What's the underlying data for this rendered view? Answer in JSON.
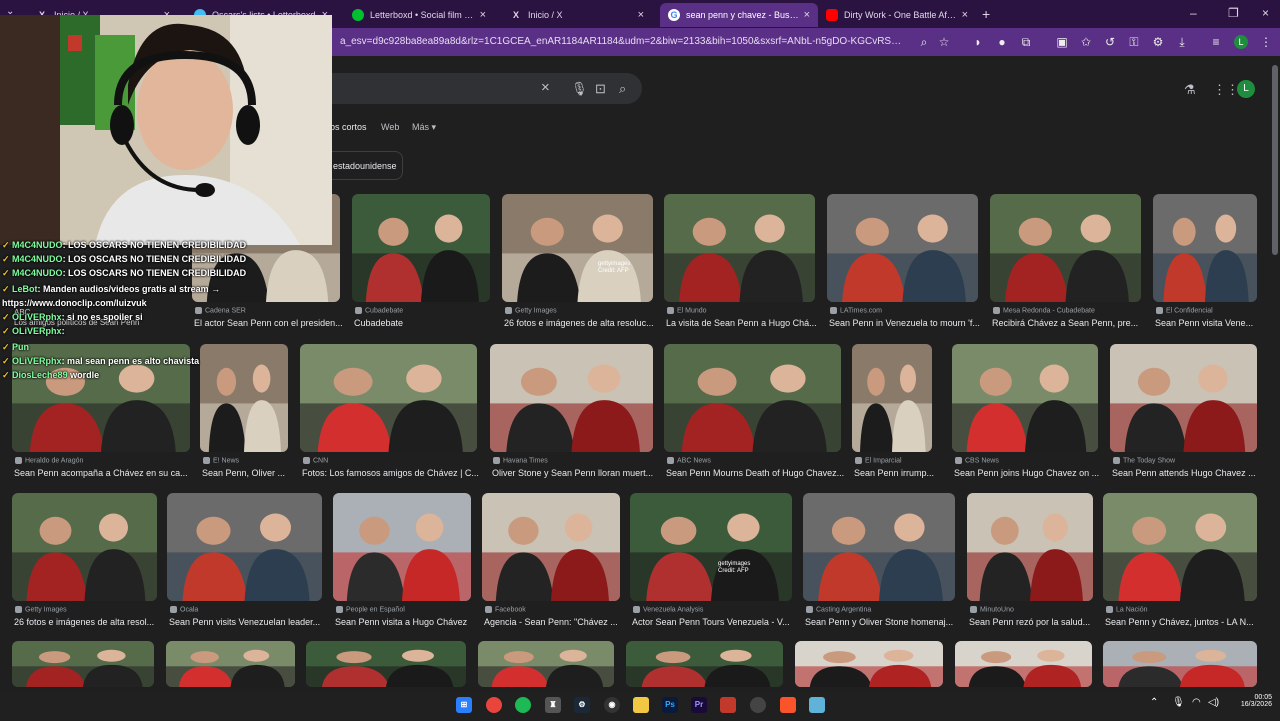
{
  "tabs": [
    {
      "label": "Inicio / X",
      "icon": "x-logo-icon"
    },
    {
      "label": "Oscars's lists • Letterboxd",
      "icon": "letterboxd-icon"
    },
    {
      "label": "Letterboxd • Social film discove",
      "icon": "letterboxd-icon"
    },
    {
      "label": "Inicio / X",
      "icon": "x-logo-icon"
    },
    {
      "label": "sean penn y chavez - Buscar co",
      "icon": "google-icon"
    },
    {
      "label": "Dirty Work - One Battle After A",
      "icon": "youtube-icon"
    }
  ],
  "toolbar": {
    "url": "a_esv=d9c928ba8ea89a8d&rlz=1C1GCEA_enAR1184AR1184&udm=2&biw=2133&bih=1050&sxsrf=ANbL-n5gDO-KGCvRS5UckiM-AMYE_...",
    "profile_initial": "L"
  },
  "search": {
    "nav_tabs": [
      "os cortos",
      "Web",
      "Más"
    ],
    "chip_label": "estadounidense",
    "profile_initial": "L"
  },
  "results": [
    {
      "source": "",
      "caption": ""
    },
    {
      "source": "Cadena SER",
      "caption": "El actor Sean Penn con el presiden..."
    },
    {
      "source": "Cubadebate",
      "caption": "Cubadebate"
    },
    {
      "source": "Getty Images",
      "caption": "26 fotos e imágenes de alta resoluc..."
    },
    {
      "source": "El Mundo",
      "caption": "La visita de Sean Penn a Hugo Chá..."
    },
    {
      "source": "LATimes.com",
      "caption": "Sean Penn in Venezuela to mourn 'f..."
    },
    {
      "source": "Mesa Redonda - Cubadebate",
      "caption": "Recibirá Chávez a Sean Penn, pre..."
    },
    {
      "source": "El Confidencial",
      "caption": "Sean Penn visita Vene..."
    },
    {
      "source": "Heraldo de Aragón",
      "caption": "Sean Penn acompaña a Chávez en su ca..."
    },
    {
      "source": "E! News",
      "caption": "Sean Penn, Oliver ..."
    },
    {
      "source": "CNN",
      "caption": "Fotos: Los famosos amigos de Chávez | C..."
    },
    {
      "source": "Havana Times",
      "caption": "Oliver Stone y Sean Penn lloran muert..."
    },
    {
      "source": "ABC News",
      "caption": "Sean Penn Mourns Death of Hugo Chavez..."
    },
    {
      "source": "El Imparcial",
      "caption": "Sean Penn irrump..."
    },
    {
      "source": "CBS News",
      "caption": "Sean Penn joins Hugo Chavez on ..."
    },
    {
      "source": "The Today Show",
      "caption": "Sean Penn attends Hugo Chavez ..."
    },
    {
      "source": "Getty Images",
      "caption": "26 fotos e imágenes de alta resol..."
    },
    {
      "source": "Ocala",
      "caption": "Sean Penn visits Venezuelan leader..."
    },
    {
      "source": "People en Español",
      "caption": "Sean Penn visita a Hugo Chávez"
    },
    {
      "source": "Facebook",
      "caption": "Agencia - Sean Penn: \"Chávez ..."
    },
    {
      "source": "Venezuela Analysis",
      "caption": "Actor Sean Penn Tours Venezuela - V..."
    },
    {
      "source": "Casting Argentina",
      "caption": "Sean Penn y Oliver Stone homenaj..."
    },
    {
      "source": "MinutoUno",
      "caption": "Sean Penn rezó por la salud..."
    },
    {
      "source": "La Nación",
      "caption": "Sean Penn y Chávez, juntos - LA N..."
    }
  ],
  "overlay_text": [
    "gettyimages",
    "Credit: AFP"
  ],
  "chat": [
    {
      "user": "M4C4NUDO",
      "message": ": LOS OSCARS NO TIENEN CREDIBILIDAD"
    },
    {
      "user": "M4C4NUDO",
      "message": ": LOS OSCARS NO TIENEN CREDIBILIDAD"
    },
    {
      "user": "M4C4NUDO",
      "message": ": LOS OSCARS NO TIENEN CREDIBILIDAD"
    },
    {
      "user": "LeBot",
      "message": ": Manden audios/videos gratis al stream →"
    },
    {
      "user": "",
      "message": "https://www.donoclip.com/luizvuk"
    },
    {
      "user": "OLiVERphx",
      "message": ": si no es spoiler si"
    },
    {
      "user": "OLiVERphx",
      "message": ":"
    },
    {
      "user": "Pun",
      "message": ""
    },
    {
      "user": "OLiVERphx",
      "message": ": mal sean penn es alto chavista"
    },
    {
      "user": "DiosLeche89",
      "message": " wordle"
    }
  ],
  "chat_underlay": [
    "ABC",
    "Los amigos políticos de Sean Penn"
  ],
  "clock": {
    "time": "00:05",
    "date": "16/3/2026"
  }
}
